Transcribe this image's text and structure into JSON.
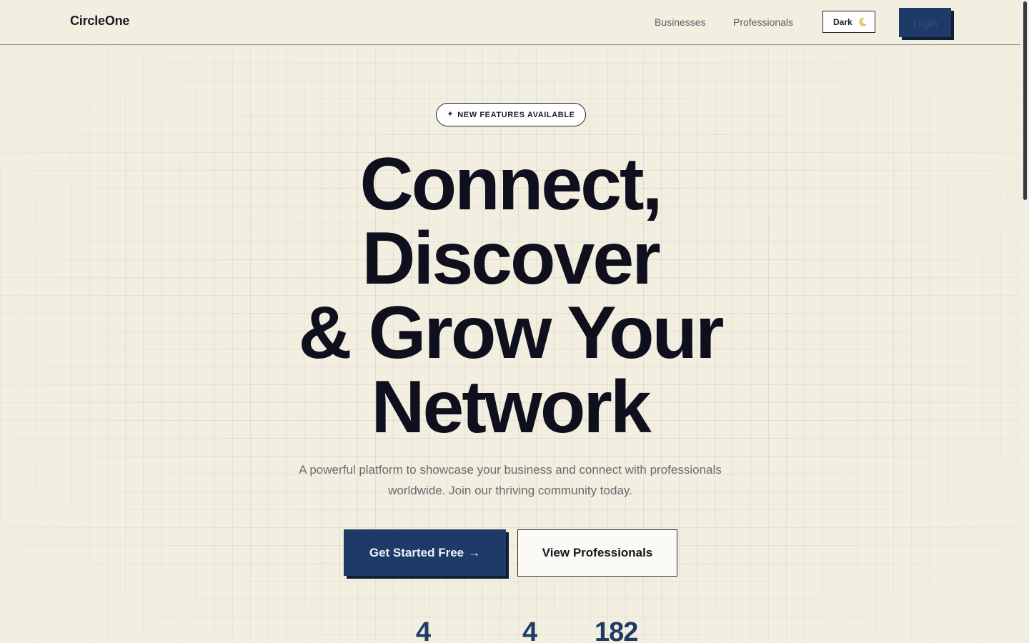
{
  "header": {
    "brand": "CircleOne",
    "nav": {
      "businesses": "Businesses",
      "professionals": "Professionals"
    },
    "theme_toggle": {
      "label": "Dark",
      "icon": "moon-icon"
    },
    "login_label": "Login"
  },
  "hero": {
    "badge": {
      "icon": "sparkle-icon",
      "symbol": "✦",
      "text": "NEW FEATURES AVAILABLE"
    },
    "title_lines": [
      "Connect,",
      "Discover",
      "& Grow Your",
      "Network"
    ],
    "subtitle": "A powerful platform to showcase your business and connect with professionals worldwide. Join our thriving community today.",
    "cta_primary": {
      "label": "Get Started Free",
      "arrow": "→"
    },
    "cta_secondary": {
      "label": "View Professionals"
    }
  },
  "stats": [
    "4",
    "4",
    "182"
  ],
  "colors": {
    "background": "#f2efe0",
    "accent": "#1e3a66",
    "text": "#0f0f1e",
    "muted": "#696a70"
  }
}
